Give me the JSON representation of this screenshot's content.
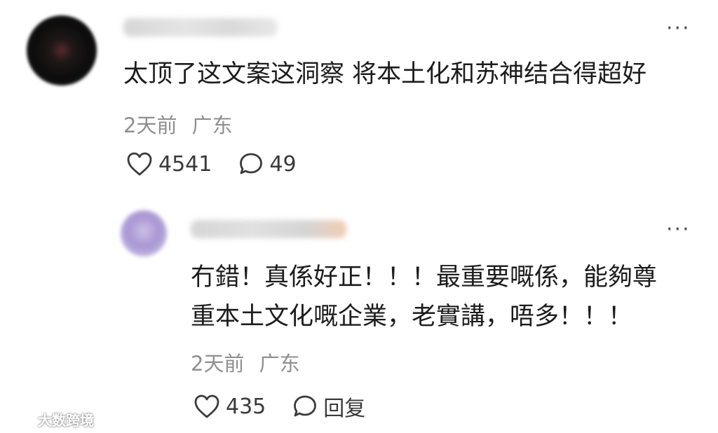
{
  "comment": {
    "text": "太顶了这文案这洞察 将本土化和苏神结合得超好",
    "time": "2天前",
    "location": "广东",
    "likes": "4541",
    "replies": "49"
  },
  "reply": {
    "text_line1": "冇錯！真係好正！！！最重要嘅係，能夠尊",
    "text_line2": "重本土文化嘅企業，老實講，唔多！！！",
    "time": "2天前",
    "location": "广东",
    "likes": "435",
    "reply_label": "回复"
  },
  "watermark": {
    "text": "大数跨境"
  },
  "icons": {
    "like": "heart-outline-icon",
    "comment": "speech-bubble-icon",
    "more": "more-dots-icon"
  }
}
